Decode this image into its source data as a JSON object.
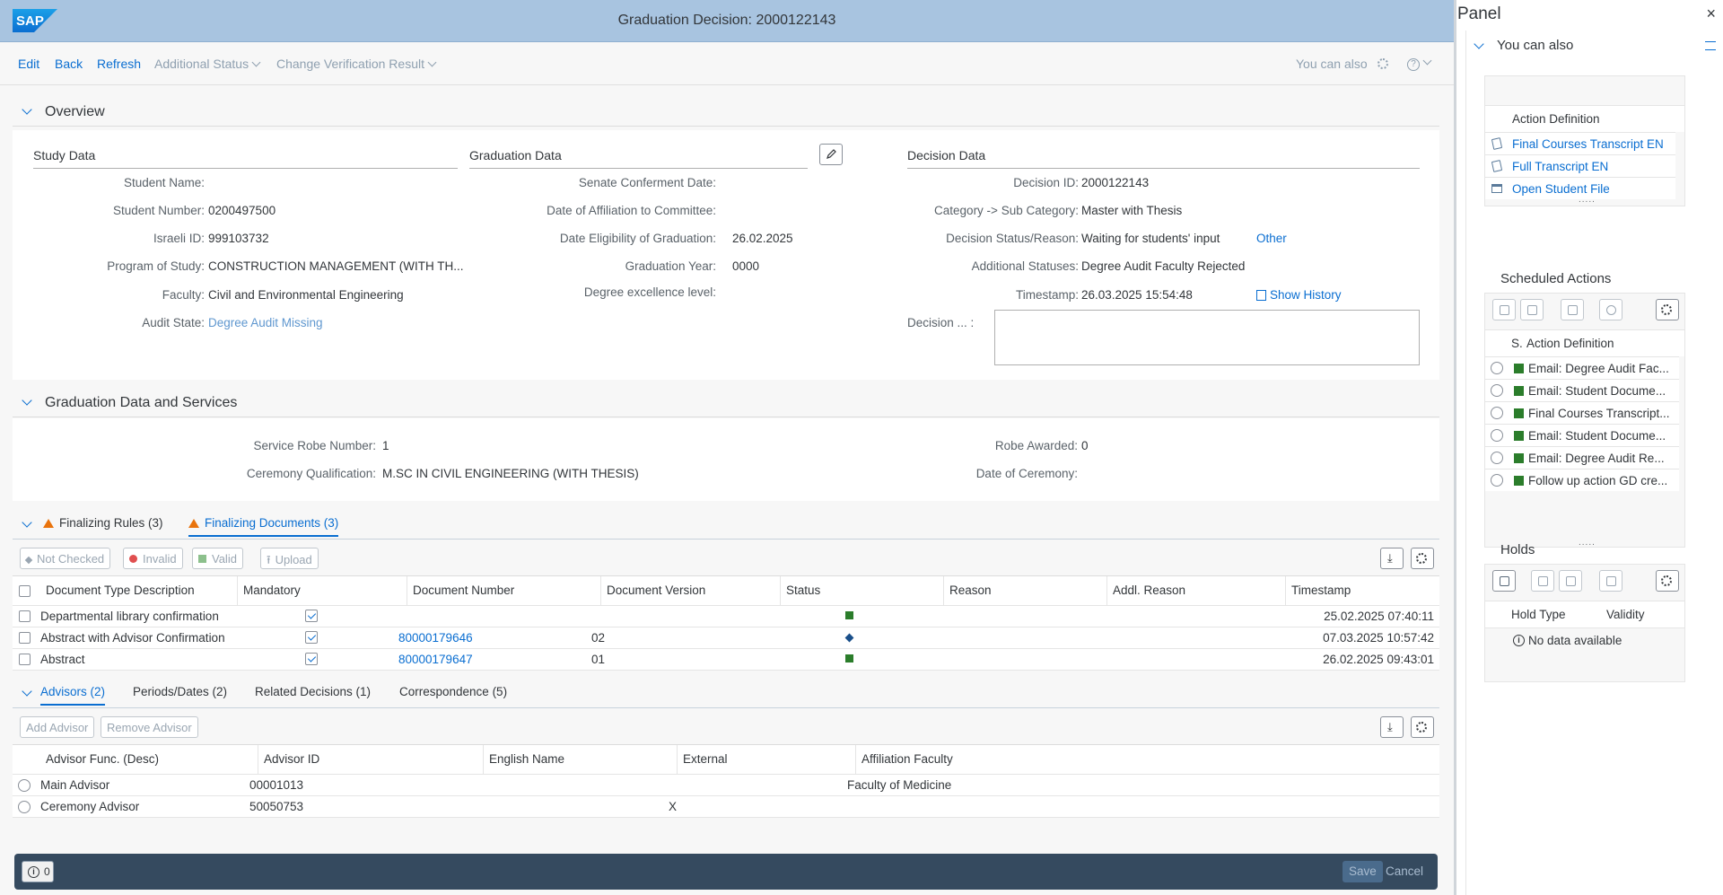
{
  "shell": {
    "logo": "SAP",
    "title": "Graduation Decision: 2000122143"
  },
  "toolbar": {
    "edit": "Edit",
    "back": "Back",
    "refresh": "Refresh",
    "additional_status": "Additional Status",
    "change_verification": "Change Verification Result",
    "you_can_also": "You can also"
  },
  "overview": {
    "title": "Overview",
    "study": {
      "title": "Study Data",
      "student_name_label": "Student Name:",
      "student_name": "",
      "student_number_label": "Student Number:",
      "student_number": "0200497500",
      "israeli_id_label": "Israeli ID:",
      "israeli_id": "999103732",
      "program_label": "Program of Study:",
      "program": "CONSTRUCTION MANAGEMENT (WITH TH...",
      "faculty_label": "Faculty:",
      "faculty": "Civil and Environmental Engineering",
      "audit_label": "Audit State:",
      "audit": "Degree Audit Missing"
    },
    "graduation": {
      "title": "Graduation Data",
      "senate_label": "Senate Conferment Date:",
      "senate": "",
      "affiliation_label": "Date of Affiliation to Committee:",
      "affiliation": "",
      "eligibility_label": "Date Eligibility of Graduation:",
      "eligibility": "26.02.2025",
      "year_label": "Graduation Year:",
      "year": "0000",
      "excellence_label": "Degree excellence level:",
      "excellence": ""
    },
    "decision": {
      "title": "Decision Data",
      "id_label": "Decision ID:",
      "id": "2000122143",
      "category_label": "Category -> Sub Category:",
      "category": "Master with Thesis",
      "status_label": "Decision Status/Reason:",
      "status": "Waiting for students' input",
      "status_link": "Other",
      "additional_label": "Additional Statuses:",
      "additional": "Degree Audit Faculty Rejected",
      "timestamp_label": "Timestamp:",
      "timestamp": "26.03.2025 15:54:48",
      "history": "Show History",
      "note_label": "Decision ... :"
    }
  },
  "services": {
    "title": "Graduation Data and Services",
    "robe_number_label": "Service Robe Number:",
    "robe_number": "1",
    "ceremony_qual_label": "Ceremony Qualification:",
    "ceremony_qual": "M.SC IN CIVIL ENGINEERING (WITH THESIS)",
    "robe_awarded_label": "Robe Awarded:",
    "robe_awarded": "0",
    "ceremony_date_label": "Date of Ceremony:",
    "ceremony_date": ""
  },
  "docs_tabs": {
    "rules": "Finalizing Rules (3)",
    "documents": "Finalizing Documents (3)"
  },
  "docs_actions": {
    "not_checked": "Not Checked",
    "invalid": "Invalid",
    "valid": "Valid",
    "upload": "Upload"
  },
  "docs_table": {
    "headers": [
      "Document Type Description",
      "Mandatory",
      "Document Number",
      "Document Version",
      "Status",
      "Reason",
      "Addl. Reason",
      "Timestamp"
    ],
    "rows": [
      {
        "desc": "Departmental library confirmation",
        "number": "",
        "version": "",
        "timestamp": "25.02.2025 07:40:11"
      },
      {
        "desc": "Abstract with Advisor Confirmation",
        "number": "80000179646",
        "version": "02",
        "timestamp": "07.03.2025 10:57:42"
      },
      {
        "desc": "Abstract",
        "number": "80000179647",
        "version": "01",
        "timestamp": "26.02.2025 09:43:01"
      }
    ]
  },
  "adv_tabs": {
    "advisors": "Advisors (2)",
    "periods": "Periods/Dates (2)",
    "related": "Related Decisions (1)",
    "correspondence": "Correspondence (5)"
  },
  "adv_actions": {
    "add": "Add Advisor",
    "remove": "Remove Advisor"
  },
  "adv_table": {
    "headers": [
      "Advisor  Func. (Desc)",
      "Advisor ID",
      "English Name",
      "External",
      "Affiliation Faculty"
    ],
    "rows": [
      {
        "func": "Main Advisor",
        "id": "00001013",
        "name": "",
        "external": "",
        "faculty": "Faculty of Medicine"
      },
      {
        "func": "Ceremony Advisor",
        "id": "50050753",
        "name": "",
        "external": "X",
        "faculty": ""
      }
    ]
  },
  "footer": {
    "messages": "0",
    "save": "Save",
    "cancel": "Cancel"
  },
  "panel": {
    "title": "Panel",
    "close": "×",
    "you_can_also": "You can also",
    "actions_header": "Action Definition",
    "actions": [
      "Final Courses Transcript EN",
      "Full Transcript EN",
      "Open Student File"
    ],
    "scheduled_title": "Scheduled Actions",
    "scheduled_header_s": "S.",
    "scheduled_header": "Action Definition",
    "scheduled": [
      "Email: Degree Audit Fac...",
      "Email: Student Docume...",
      "Final Courses Transcript...",
      "Email: Student Docume...",
      "Email: Degree Audit Re...",
      "Follow up action GD cre..."
    ],
    "holds_title": "Holds",
    "holds_type": "Hold Type",
    "holds_validity": "Validity",
    "holds_empty": "No data available"
  }
}
